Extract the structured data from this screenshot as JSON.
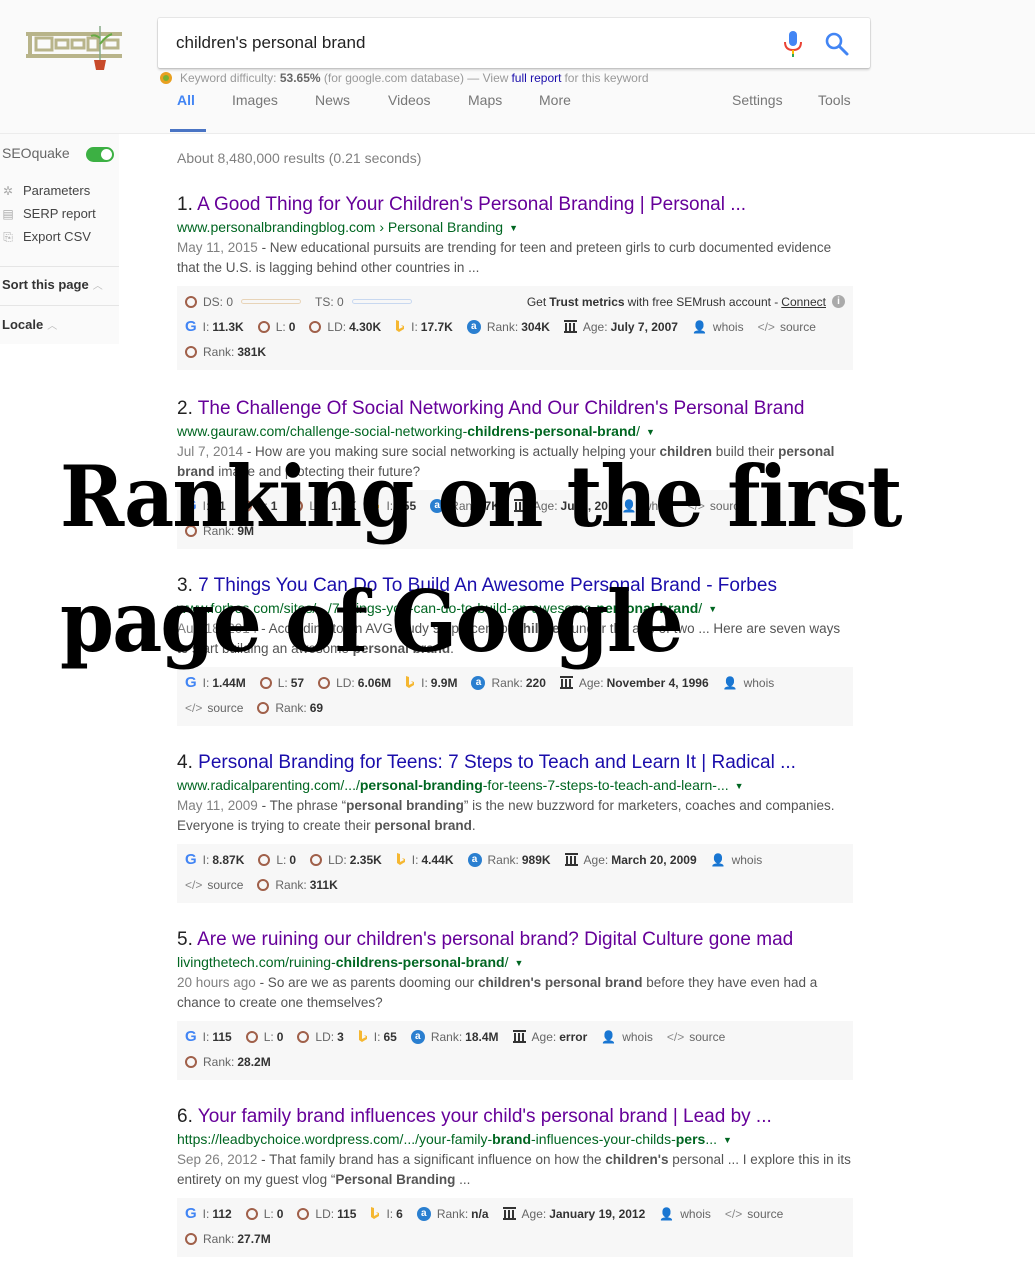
{
  "search": {
    "query": "children's personal brand",
    "mic_icon": "microphone-icon",
    "search_icon": "magnifier-icon"
  },
  "keyword_difficulty": {
    "label": "Keyword difficulty:",
    "value": "53.65%",
    "database": "(for google.com database) — View",
    "link": "full report",
    "suffix": "for this keyword"
  },
  "tabs": [
    {
      "label": "All",
      "active": true
    },
    {
      "label": "Images"
    },
    {
      "label": "News"
    },
    {
      "label": "Videos"
    },
    {
      "label": "Maps"
    },
    {
      "label": "More"
    },
    {
      "label": "Settings"
    },
    {
      "label": "Tools"
    }
  ],
  "sidebar": {
    "title": "SEOquake",
    "toggle_on": true,
    "items": [
      {
        "label": "Parameters",
        "icon": "gear-icon"
      },
      {
        "label": "SERP report",
        "icon": "report-icon"
      },
      {
        "label": "Export CSV",
        "icon": "export-icon"
      }
    ],
    "sort_label": "Sort this page",
    "locale_label": "Locale"
  },
  "stats": "About 8,480,000 results (0.21 seconds)",
  "overlay": {
    "line1": "Ranking on the first",
    "line2": "page of Google"
  },
  "results": [
    {
      "num": "1.",
      "title": "A Good Thing for Your Children's Personal Branding | Personal ...",
      "url_pre": "www.personalbrandingblog.com › Personal Branding",
      "url_bold": "",
      "url_post": "",
      "date": "May 11, 2015",
      "snippet": " - New educational pursuits are trending for teen and preteen girls to curb documented evidence that the U.S. is lagging behind other countries in ...",
      "trust": {
        "ds": "DS: 0",
        "ts": "TS: 0",
        "text_pre": "Get",
        "text_bold": "Trust metrics",
        "text_post": "with free SEMrush account -",
        "link": "Connect"
      },
      "metrics": {
        "gi": "11.3K",
        "l": "0",
        "ld": "4.30K",
        "bi": "17.7K",
        "arank": "304K",
        "age": "July 7, 2007",
        "rank": "381K"
      }
    },
    {
      "num": "2.",
      "title": "The Challenge Of Social Networking And Our Children's Personal Brand",
      "url_pre": "www.gauraw.com/challenge-social-networking-",
      "url_bold": "childrens-personal-brand",
      "url_post": "/",
      "date": "Jul 7, 2014",
      "snippet_html": " - How are you making sure social networking is actually helping your <b>children</b> build their <b>personal brand</b> image and protecting their future?",
      "metrics": {
        "gi": "61",
        "l": "1",
        "ld": "1.0K",
        "bi": "355",
        "arank": "7K",
        "age": "July , 20",
        "rank": "9M"
      }
    },
    {
      "num": "3.",
      "title": "7 Things You Can Do To Build An Awesome Personal Brand - Forbes",
      "url_pre": "www.forbes.com/sites/.../7-things-you-can-do-to-build-an-awesome-",
      "url_bold": "personal-brand",
      "url_post": "/",
      "date": "Aug 18, 2014",
      "snippet_html": " - According to an AVG study 92 percent of <b>children</b> under the age of two ... Here are seven ways to start building an awesome <b>personal brand</b>.",
      "metrics": {
        "gi": "1.44M",
        "l": "57",
        "ld": "6.06M",
        "bi": "9.9M",
        "arank": "220",
        "age": "November 4, 1996",
        "rank": "69"
      }
    },
    {
      "num": "4.",
      "title": "Personal Branding for Teens: 7 Steps to Teach and Learn It | Radical ...",
      "url_pre": "www.radicalparenting.com/.../",
      "url_bold": "personal-branding",
      "url_post": "-for-teens-7-steps-to-teach-and-learn-...",
      "date": "May 11, 2009",
      "snippet_html": " - The phrase “<b>personal branding</b>” is the new buzzword for marketers, coaches and companies. Everyone is trying to create their <b>personal brand</b>.",
      "metrics": {
        "gi": "8.87K",
        "l": "0",
        "ld": "2.35K",
        "bi": "4.44K",
        "arank": "989K",
        "age": "March 20, 2009",
        "rank": "311K"
      }
    },
    {
      "num": "5.",
      "title": "Are we ruining our children's personal brand? Digital Culture gone mad",
      "url_pre": "livingthetech.com/ruining-",
      "url_bold": "childrens-personal-brand",
      "url_post": "/",
      "date": "20 hours ago",
      "snippet_html": " - So are we as parents dooming our <b>children's personal brand</b> before they have even had a chance to create one themselves?",
      "metrics": {
        "gi": "115",
        "l": "0",
        "ld": "3",
        "bi": "65",
        "arank": "18.4M",
        "age": "error",
        "rank": "28.2M"
      }
    },
    {
      "num": "6.",
      "title": "Your family brand influences your child's personal brand | Lead by ...",
      "url_pre": "https://leadbychoice.wordpress.com/.../your-family-",
      "url_bold": "brand",
      "url_post": "-influences-your-childs-",
      "url_bold2": "pers",
      "url_post2": "...",
      "date": "Sep 26, 2012",
      "snippet_html": " - That family brand has a significant influence on how the <b>children's</b> personal ... I explore this in its entirety on my guest vlog “<b>Personal Branding</b> ...",
      "metrics": {
        "gi": "112",
        "l": "0",
        "ld": "115",
        "bi": "6",
        "arank": "n/a",
        "age": "January 19, 2012",
        "rank": "27.7M"
      }
    }
  ],
  "metric_labels": {
    "gi": "I:",
    "l": "L:",
    "ld": "LD:",
    "bi": "I:",
    "arank": "Rank:",
    "age": "Age:",
    "whois": "whois",
    "source": "source",
    "rank": "Rank:"
  },
  "colors": {
    "title_visited": "#660099",
    "title_link": "#1a0dab",
    "url_green": "#006621",
    "accent_blue": "#4285f4",
    "toggle_green": "#3cb043"
  }
}
